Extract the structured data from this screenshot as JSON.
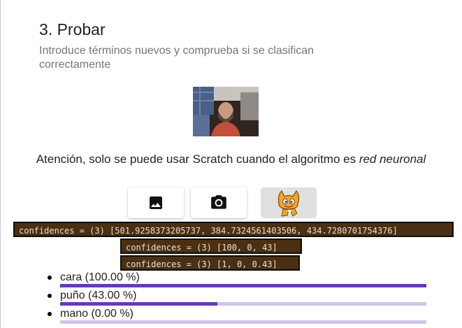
{
  "section": {
    "title": "3. Probar",
    "subtitle": "Introduce términos nuevos y comprueba si se clasifican correctamente"
  },
  "notice": {
    "text_before": "Atención, solo se puede usar Scratch cuando el algoritmo es ",
    "text_emphasis": "red neuronal"
  },
  "mode_buttons": [
    {
      "icon": "image-icon",
      "active": false
    },
    {
      "icon": "camera-icon",
      "active": false
    },
    {
      "icon": "scratch-cat-icon",
      "active": true
    }
  ],
  "console": [
    "confidences = (3) [501.9258373205737, 384.7324561403506, 434.7280701754376]",
    "confidences = (3) [100, 0, 43]",
    "confidences = (3) [1, 0, 0.43]"
  ],
  "results": [
    {
      "label": "cara (100.00 %)",
      "value": 1.0
    },
    {
      "label": "puño (43.00 %)",
      "value": 0.43
    },
    {
      "label": "mano (0.00 %)",
      "value": 0.0
    }
  ],
  "colors": {
    "bar_fill": "#673ab7",
    "bar_track": "#d1c4e9",
    "console_bg": "#4a2f12"
  }
}
